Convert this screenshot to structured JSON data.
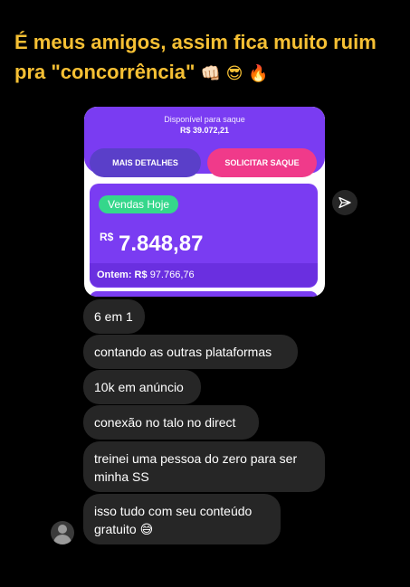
{
  "headline": {
    "text": "É meus amigos, assim fica muito ruim pra \"concorrência\"",
    "emojis": "👊🏻 😎 🔥"
  },
  "screenshot": {
    "available_label": "Disponível para saque",
    "available_value": "R$ 39.072,21",
    "details_button": "MAIS DETALHES",
    "withdraw_button": "SOLICITAR SAQUE",
    "sales_badge": "Vendas Hoje",
    "currency": "R$",
    "sales_value": "7.848,87",
    "yesterday_label": "Ontem: R$",
    "yesterday_value": "97.766,76",
    "colors": {
      "purple": "#7a3cf2",
      "pink": "#f03a8a",
      "green": "#35d78b"
    }
  },
  "messages": [
    {
      "text": "6 em 1"
    },
    {
      "text": "contando as outras plataformas"
    },
    {
      "text": "10k em anúncio"
    },
    {
      "text": "conexão no talo no direct"
    },
    {
      "text": "treinei uma pessoa do zero para ser minha SS"
    },
    {
      "text": "isso tudo com seu conteúdo gratuito 😅"
    }
  ],
  "icons": {
    "send": "send-icon",
    "avatar": "avatar"
  }
}
